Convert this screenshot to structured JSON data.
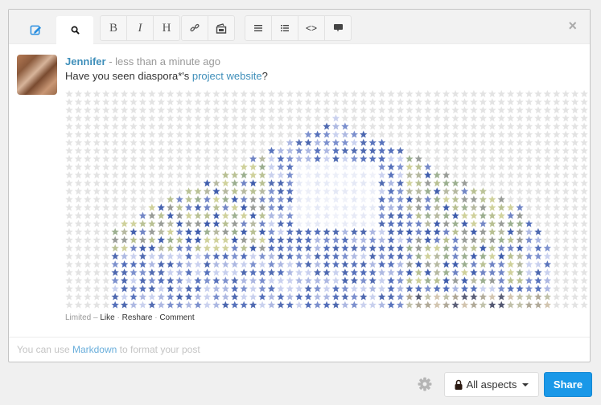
{
  "toolbar": {
    "tabs": [
      {
        "name": "write",
        "icon": "pencil-square-icon"
      },
      {
        "name": "preview",
        "icon": "search-icon",
        "active": true
      }
    ],
    "format_buttons": [
      {
        "label": "B",
        "name": "bold"
      },
      {
        "label": "I",
        "name": "italic"
      },
      {
        "label": "H",
        "name": "heading"
      }
    ],
    "insert_buttons": [
      {
        "name": "link",
        "icon": "link-icon"
      },
      {
        "name": "image",
        "icon": "image-icon"
      }
    ],
    "block_buttons": [
      {
        "name": "ordered-list",
        "icon": "ordered-list-icon"
      },
      {
        "name": "unordered-list",
        "icon": "unordered-list-icon"
      },
      {
        "name": "code",
        "icon": "code-icon",
        "label": "<>"
      },
      {
        "name": "quote",
        "icon": "quote-icon"
      }
    ],
    "close_label": "×"
  },
  "post": {
    "author": "Jennifer",
    "time": " - less than a minute ago",
    "text_before": "Have you seen diaspora*'s ",
    "link_text": "project website",
    "text_after": "?",
    "actions": {
      "visibility": "Limited",
      "separator": " – ",
      "like": "Like",
      "dot": " · ",
      "reshare": "Reshare",
      "comment": "Comment"
    }
  },
  "footer": {
    "hint_before": "You can use ",
    "hint_link": "Markdown",
    "hint_after": " to format your post"
  },
  "controls": {
    "aspects_label": "All aspects",
    "share_label": "Share"
  },
  "colors": {
    "accent": "#1a98e8",
    "link": "#3f8fba",
    "star_empty": "#e2e2e2",
    "star_blue": "#2a4aa0",
    "star_green": "#7a9070",
    "star_olive": "#c8c878"
  }
}
